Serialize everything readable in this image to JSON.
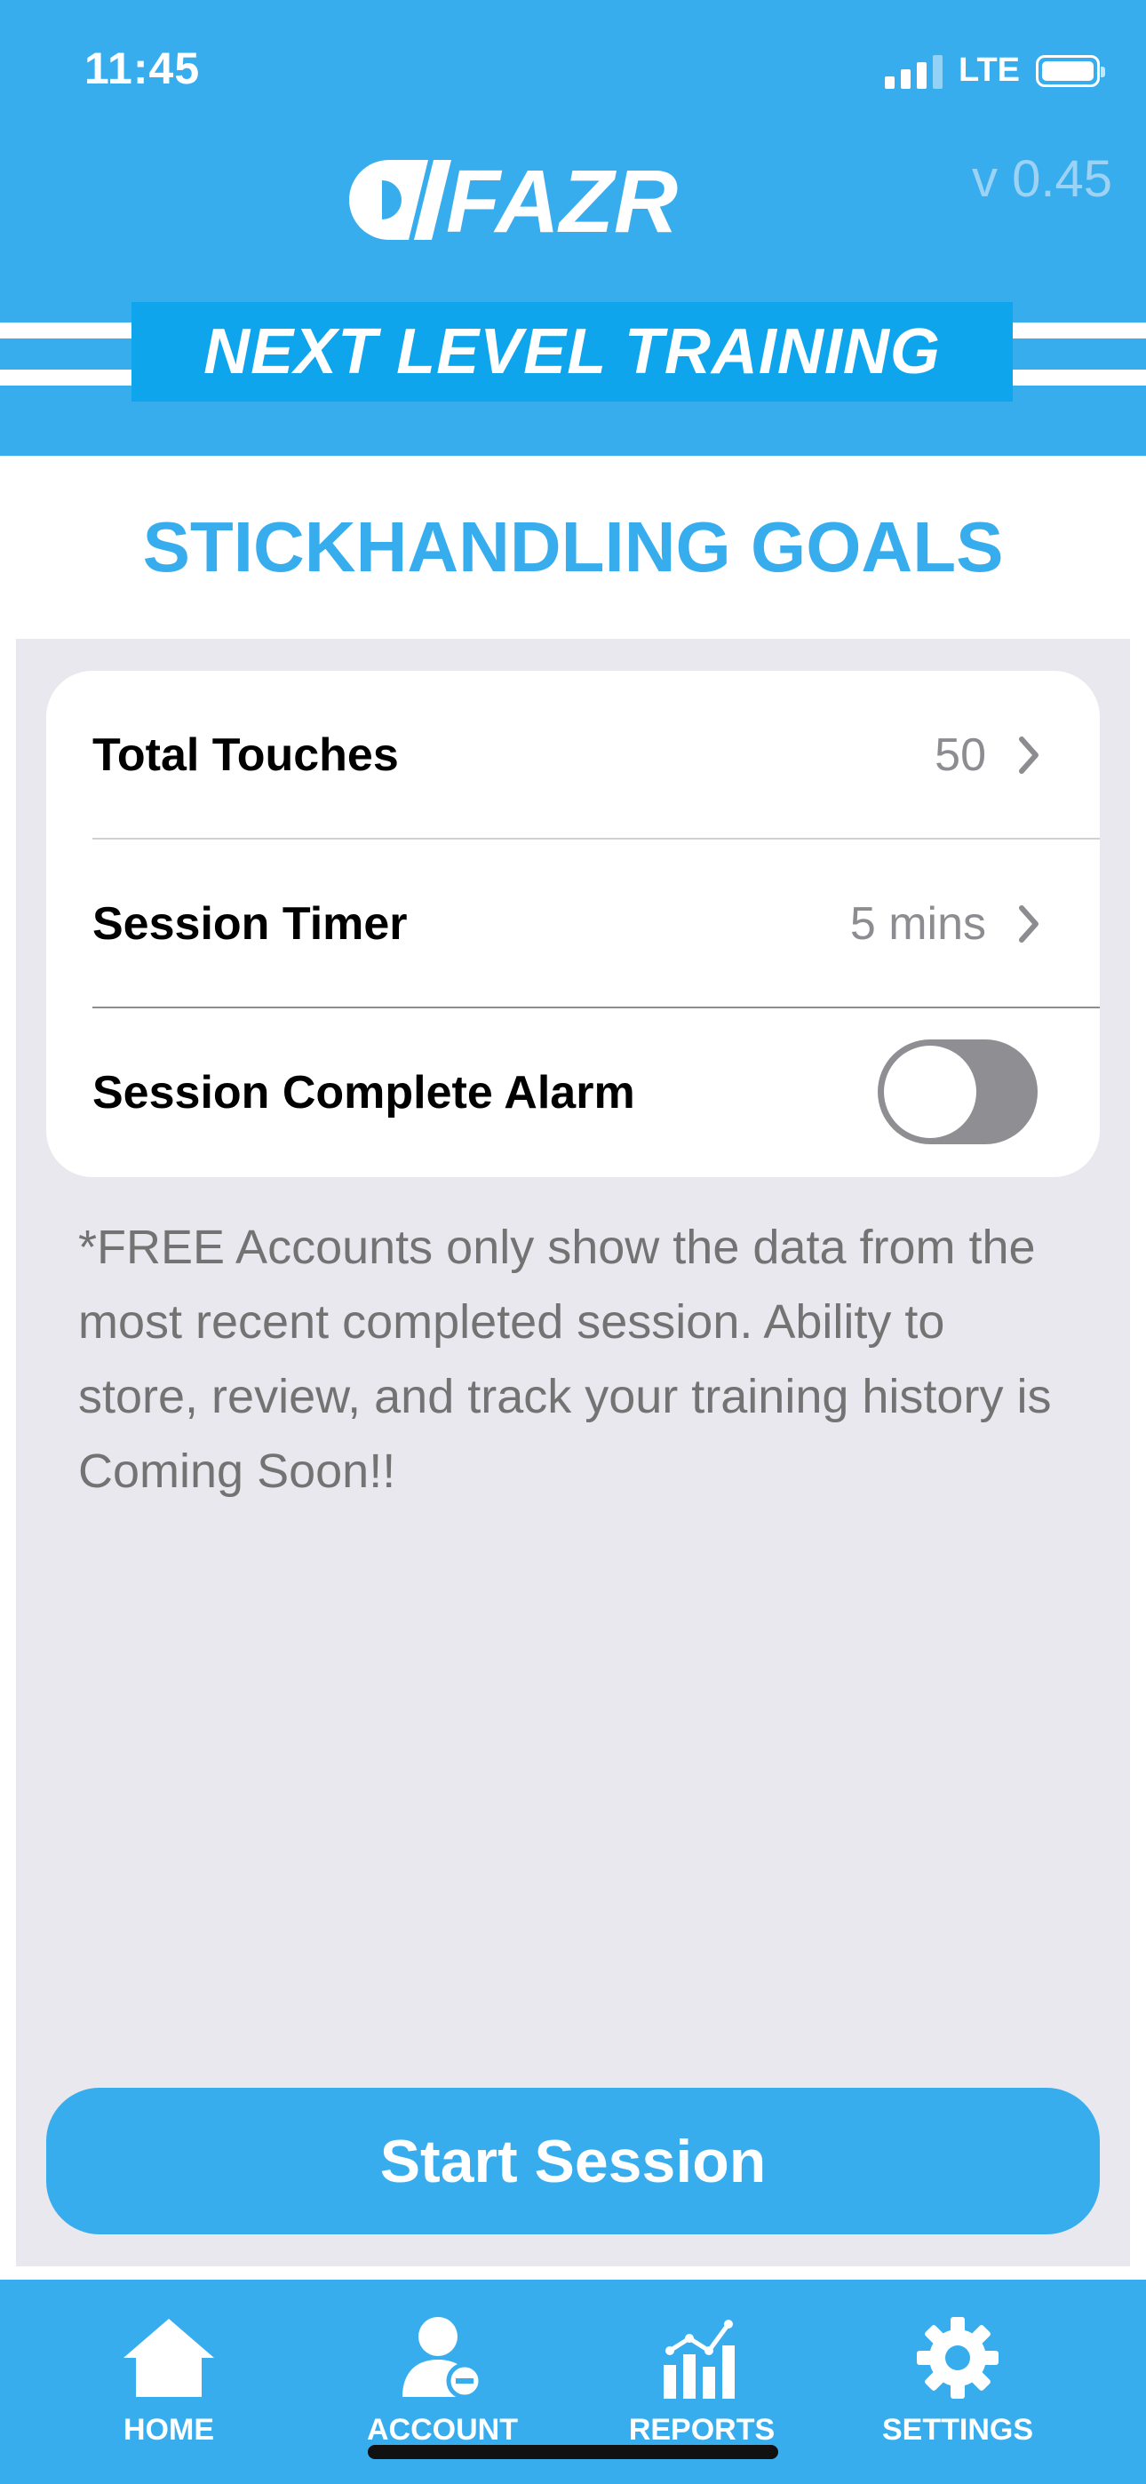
{
  "status_bar": {
    "time": "11:45",
    "network": "LTE"
  },
  "header": {
    "logo_text": "FAZR",
    "version": "v 0.45",
    "banner": "NEXT LEVEL TRAINING"
  },
  "page": {
    "title": "STICKHANDLING GOALS"
  },
  "settings": {
    "total_touches": {
      "label": "Total Touches",
      "value": "50"
    },
    "session_timer": {
      "label": "Session Timer",
      "value": "5 mins"
    },
    "alarm": {
      "label": "Session Complete Alarm",
      "enabled": false
    }
  },
  "note": "*FREE Accounts only show the data from the most recent completed session. Ability to store, review, and track your training history is Coming Soon!!",
  "actions": {
    "start_label": "Start Session"
  },
  "tabs": [
    {
      "label": "HOME",
      "icon": "home-icon"
    },
    {
      "label": "ACCOUNT",
      "icon": "account-icon"
    },
    {
      "label": "REPORTS",
      "icon": "reports-icon"
    },
    {
      "label": "SETTINGS",
      "icon": "gear-icon"
    }
  ],
  "colors": {
    "brand_blue": "#38adee",
    "banner_blue": "#0ea5ec",
    "background_gray": "#e9e8ee",
    "toggle_off": "#8e8e93"
  }
}
